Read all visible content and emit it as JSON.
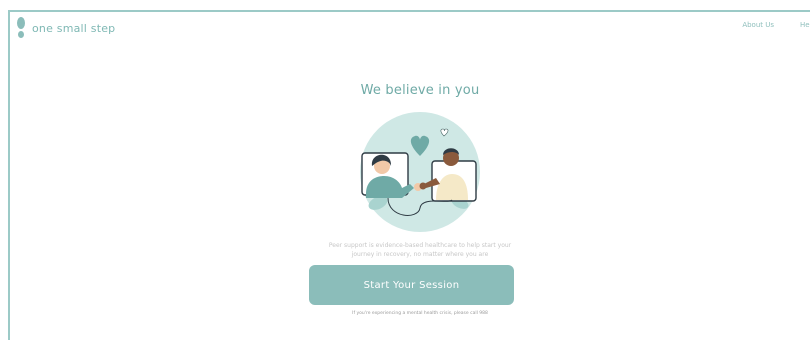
{
  "header": {
    "logo_text": "one small step",
    "nav": {
      "about": "About Us",
      "help": "Help"
    }
  },
  "hero": {
    "headline": "We believe in you",
    "tagline_line1": "Peer support is evidence-based healthcare to help start your",
    "tagline_line2": "journey in recovery, no matter where you are",
    "cta_label": "Start Your Session",
    "crisis_note": "If you're experiencing a mental health crisis, please call 988"
  },
  "colors": {
    "accent": "#8bbdba",
    "accent_dark": "#6faaa6",
    "border": "#9ccac7",
    "illustration_bg": "#cfe8e5"
  },
  "icons": {
    "logo": "footprint-icon",
    "illustration": "video-call-illustration"
  }
}
